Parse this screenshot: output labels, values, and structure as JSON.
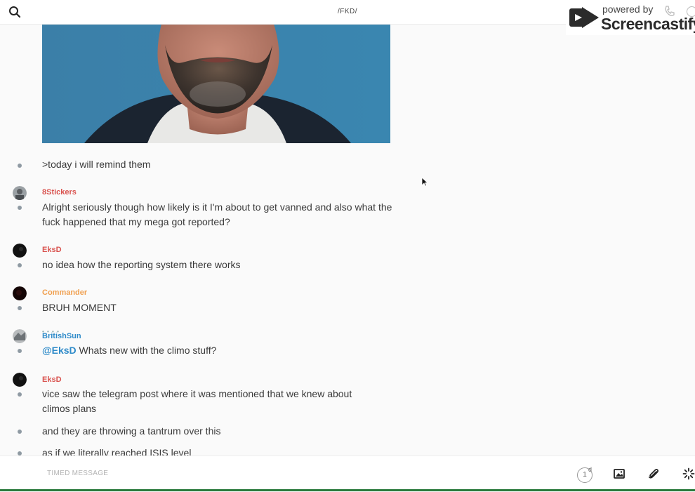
{
  "header": {
    "channel_title": "/FKD/",
    "search_icon": "search-icon"
  },
  "watermark": {
    "powered_by": "powered by",
    "brand": "Screencastify"
  },
  "messages": [
    {
      "user": "",
      "text": ">today i will remind them"
    },
    {
      "user": "8Stickers",
      "user_color": "#d9534f",
      "text": "Alright seriously though how likely is it I'm about to get vanned and also what the fuck happened that my mega got reported?"
    },
    {
      "user": "EksD",
      "user_color": "#d9534f",
      "text": "no idea how the reporting system there works"
    },
    {
      "user": "Commander",
      "user_color": "#f0a050",
      "text": "BRUH MOMENT"
    },
    {
      "user": "BritishSun",
      "user_color": "#2f8bc9",
      "mention": "@EksD",
      "text": " Whats new with the climo stuff?"
    },
    {
      "user": "EksD",
      "user_color": "#d9534f",
      "text": "vice saw the telegram post where it was mentioned that we knew about climos plans"
    },
    {
      "user": "",
      "text": "and they are throwing a tantrum over this"
    },
    {
      "user": "",
      "text": "as if we literally reached ISIS level"
    }
  ],
  "composer": {
    "placeholder": "TIMED MESSAGE",
    "timer_value": "1",
    "timer_unit": "d"
  }
}
